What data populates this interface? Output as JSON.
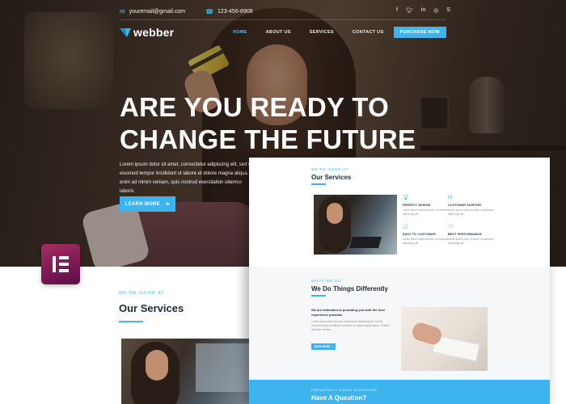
{
  "topbar": {
    "email": "youremail@gmail.com",
    "phone": "123-456-8908",
    "email_icon": "envelope-icon",
    "phone_icon": "phone-icon",
    "socials": [
      "facebook-icon",
      "twitter-icon",
      "linkedin-icon",
      "instagram-icon",
      "skype-icon"
    ]
  },
  "brand": {
    "name": "webber",
    "accent": "#3db4ee"
  },
  "nav": {
    "items": [
      {
        "label": "HOME",
        "active": true
      },
      {
        "label": "ABOUT US",
        "active": false
      },
      {
        "label": "SERVICES",
        "active": false
      },
      {
        "label": "CONTACT US",
        "active": false
      }
    ],
    "cta": "PURCHASE NOW"
  },
  "hero": {
    "title_line1": "ARE YOU READY TO",
    "title_line2": "CHANGE THE FUTURE",
    "text": "Lorem ipsum dolor sit amet, consectetur adipiscing elit, sed do eiusmod tempor incididunt ut labore et dolore magna aliqua. Ut enim ad minim veniam, quis nostrud exercitation ullamco laboris",
    "button": "LEARN MORE"
  },
  "lower": {
    "kicker": "WE'RE GOOD AT",
    "title": "Our Services"
  },
  "preview": {
    "services_kicker": "WE'RE GOOD AT",
    "services_title": "Our Services",
    "features": [
      {
        "icon": "trophy-icon",
        "title": "PERFECT DESIGN",
        "desc": "Lorem ipsum dolor sit amet, consectetur adipiscing elit."
      },
      {
        "icon": "headset-icon",
        "title": "CUSTOMER SUPPORT",
        "desc": "Lorem ipsum dolor sit amet, consectetur adipiscing elit."
      },
      {
        "icon": "user-icon",
        "title": "EASY TO CUSTOMIZE",
        "desc": "Lorem ipsum dolor sit amet, consectetur adipiscing elit."
      },
      {
        "icon": "chat-icon",
        "title": "BEST PERFORMANCE",
        "desc": "Lorem ipsum dolor sit amet, consectetur adipiscing elit."
      }
    ],
    "diff_kicker": "WHAT WE DO",
    "diff_title": "We Do Things Differently",
    "diff_lead": "We are dedicated to providing you with the best experience possible.",
    "diff_text": "Lorem ipsum dolor sit amet, consectetur adipiscing elit, sed do eiusmod tempor incididunt ut labore et dolore magna aliqua. Ut enim ad minim veniam.",
    "diff_button": "READ MORE",
    "cta_kicker": "FREQUENTLY ASKED QUESTIONS",
    "cta_title": "Have A Question?"
  },
  "elementor_badge": {
    "icon": "elementor-logo-icon",
    "color": "#92274f"
  }
}
